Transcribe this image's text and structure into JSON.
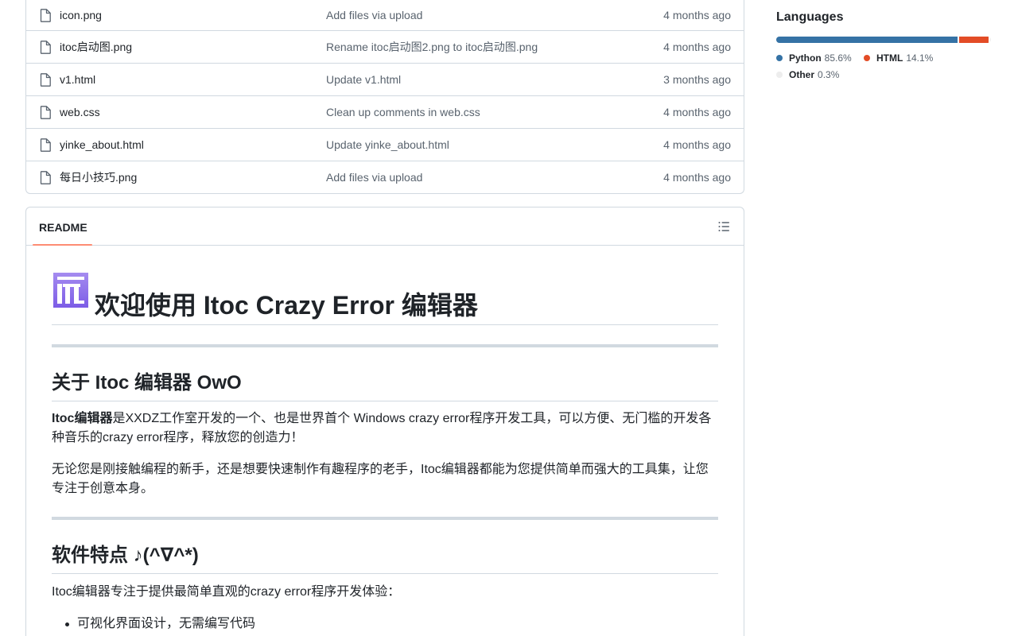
{
  "files": [
    {
      "name": "icon.png",
      "message": "Add files via upload",
      "time": "4 months ago"
    },
    {
      "name": "itoc启动图.png",
      "message": "Rename itoc启动图2.png to itoc启动图.png",
      "time": "4 months ago"
    },
    {
      "name": "v1.html",
      "message": "Update v1.html",
      "time": "3 months ago"
    },
    {
      "name": "web.css",
      "message": "Clean up comments in web.css",
      "time": "4 months ago"
    },
    {
      "name": "yinke_about.html",
      "message": "Update yinke_about.html",
      "time": "4 months ago"
    },
    {
      "name": "每日小技巧.png",
      "message": "Add files via upload",
      "time": "4 months ago"
    }
  ],
  "readme": {
    "tab_label": "README",
    "h1": "欢迎使用 Itoc Crazy Error 编辑器",
    "h2_about": "关于 Itoc 编辑器 OwO",
    "p1_bold": "Itoc编辑器",
    "p1_rest": "是XXDZ工作室开发的一个、也是世界首个 Windows crazy error程序开发工具，可以方便、无门槛的开发各种音乐的crazy error程序，释放您的创造力！",
    "p2": "无论您是刚接触编程的新手，还是想要快速制作有趣程序的老手，Itoc编辑器都能为您提供简单而强大的工具集，让您专注于创意本身。",
    "h2_features": "软件特点 ♪(^∇^*)",
    "p3": "Itoc编辑器专注于提供最简单直观的crazy error程序开发体验：",
    "list": [
      "可视化界面设计，无需编写代码"
    ]
  },
  "languages": {
    "title": "Languages",
    "items": [
      {
        "name": "Python",
        "percent": "85.6%",
        "value": 85.6,
        "color": "#3572A5"
      },
      {
        "name": "HTML",
        "percent": "14.1%",
        "value": 14.1,
        "color": "#e34c26"
      },
      {
        "name": "Other",
        "percent": "0.3%",
        "value": 0.3,
        "color": "#ededed"
      }
    ]
  },
  "icons": {
    "file": "file-icon",
    "outline": "list-unordered-icon",
    "logo": "itoc-logo"
  }
}
